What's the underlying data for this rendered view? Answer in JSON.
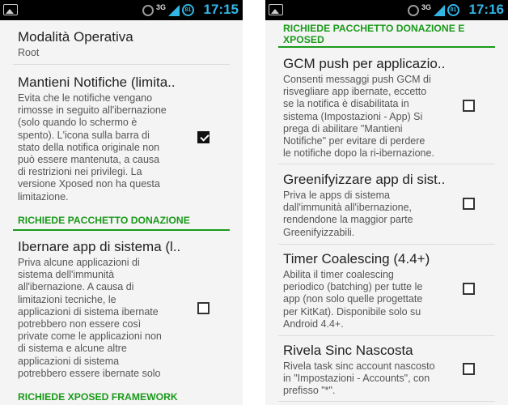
{
  "left": {
    "status": {
      "clock": "17:15",
      "network": "3G",
      "battery": "81"
    },
    "prefs": [
      {
        "title": "Modalità Operativa",
        "summary": "Root"
      },
      {
        "title": "Mantieni Notifiche (limita..",
        "summary": "Evita che le notifiche vengano rimosse in seguito all'ibernazione (solo quando lo schermo è spento). L'icona sulla barra di stato della notifica originale non può essere mantenuta, a causa di restrizioni nei privilegi. La versione Xposed non ha questa limitazione.",
        "checked": true
      },
      {
        "title": "Ibernare app di sistema (l..",
        "summary": "Priva alcune applicazioni di sistema dell'immunità all'ibernazione. A causa di limitazioni tecniche, le applicazioni di sistema ibernate potrebbero non essere così private come le applicazioni non di sistema e alcune altre applicazioni di sistema potrebbero essere ibernate solo",
        "checked": false
      }
    ],
    "categories": [
      "RICHIEDE PACCHETTO DONAZIONE",
      "RICHIEDE XPOSED FRAMEWORK"
    ]
  },
  "right": {
    "status": {
      "clock": "17:16",
      "network": "3G",
      "battery": "81"
    },
    "category": "RICHIEDE PACCHETTO DONAZIONE E XPOSED",
    "prefs": [
      {
        "title": "GCM push per applicazio..",
        "summary": "Consenti messaggi push GCM di risvegliare app ibernate, eccetto se la notifica è disabilitata in sistema (Impostazioni - App) Si prega di abilitare \"Mantieni Notifiche\" per evitare di perdere le notifiche dopo la ri-ibernazione.",
        "checked": false
      },
      {
        "title": "Greenifyizzare app di sist..",
        "summary": "Priva le apps di sistema dall'immunità all'ibernazione, rendendone la maggior parte Greenifyizzabili.",
        "checked": false
      },
      {
        "title": "Timer Coalescing (4.4+)",
        "summary": "Abilita il timer coalescing periodico (batching) per tutte le app (non solo quelle progettate per KitKat). Disponibile solo su Android 4.4+.",
        "checked": false
      },
      {
        "title": "Rivela Sinc Nascosta",
        "summary": "Rivela task sinc account nascosto in \"Impostazioni - Accounts\", con prefisso \"*\".",
        "checked": false
      }
    ]
  }
}
